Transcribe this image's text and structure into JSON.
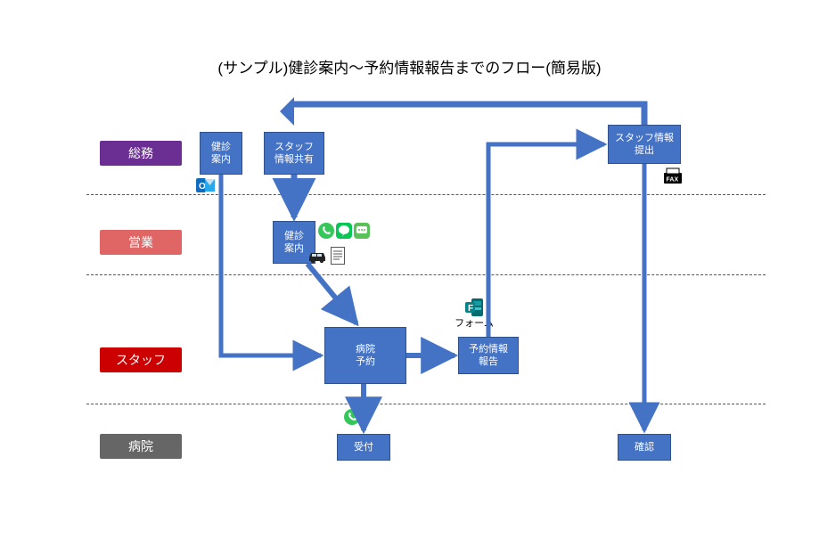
{
  "title": "(サンプル)健診案内～予約情報報告までのフロー(簡易版)",
  "lanes": {
    "soumu": "総務",
    "eigyo": "営業",
    "staff": "スタッフ",
    "byouin": "病院"
  },
  "boxes": {
    "kenshin_annai_1": "健診\n案内",
    "staff_jouhou_kyouyuu": "スタッフ\n情報共有",
    "kenshin_annai_2": "健診\n案内",
    "byouin_yoyaku": "病院\n予約",
    "yoyaku_jouhou_houkoku": "予約情報\n報告",
    "staff_jouhou_teishutsu": "スタッフ情報\n提出",
    "uketsuke": "受付",
    "kakunin": "確認"
  },
  "captions": {
    "form": "フォーム"
  },
  "icons": {
    "outlook": "outlook-icon",
    "phone1": "phone-icon",
    "line": "line-icon",
    "sms": "sms-icon",
    "car": "car-icon",
    "doc": "document-icon",
    "forms": "ms-forms-icon",
    "phone2": "phone-icon",
    "fax": "fax-icon"
  },
  "colors": {
    "box": "#4472c4",
    "arrow": "#4472c4"
  }
}
